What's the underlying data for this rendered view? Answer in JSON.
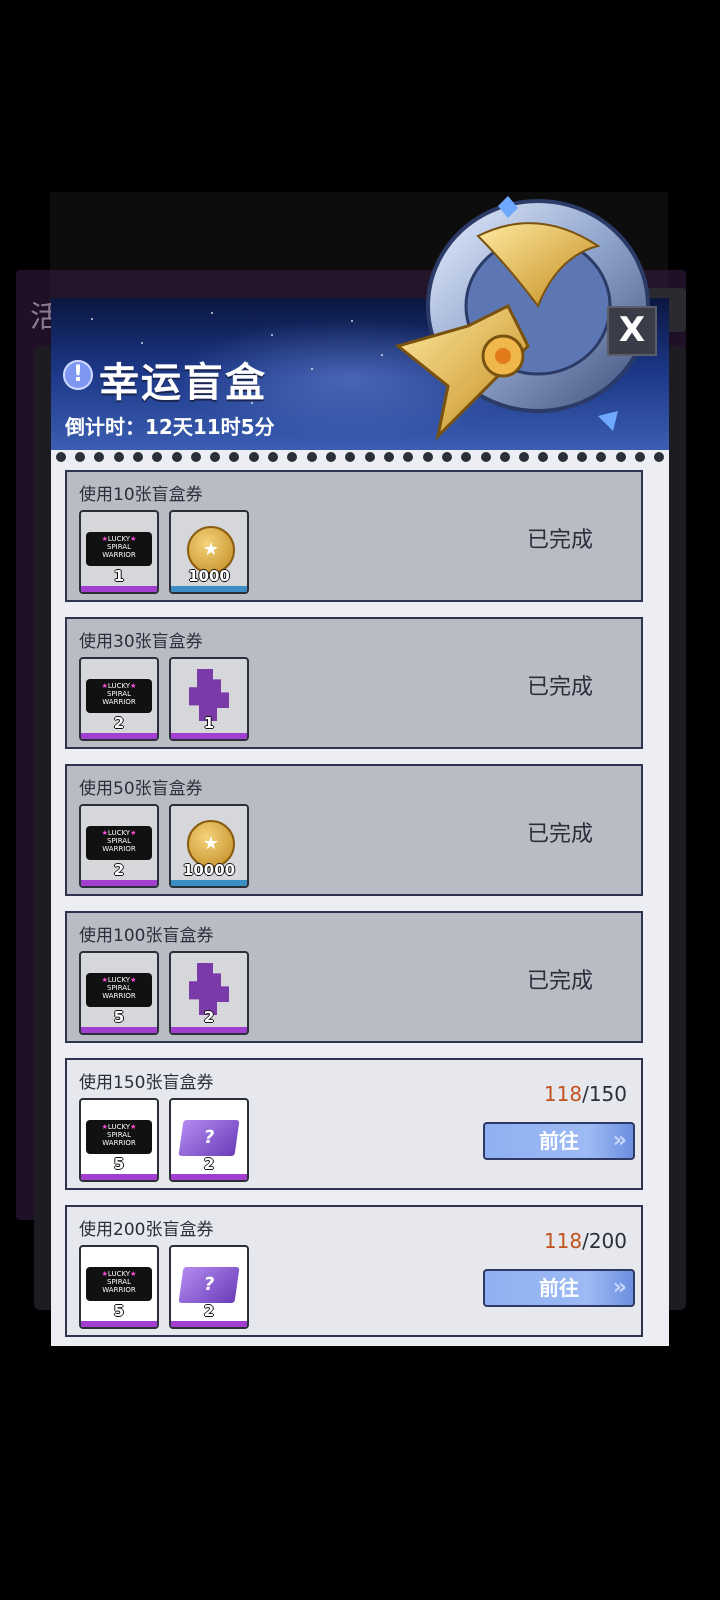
{
  "panel": {
    "title": "幸运盲盒",
    "countdown": "倒计时：12天11时5分",
    "close_label": "X"
  },
  "background": {
    "title_fragment": "活",
    "button_fragment": "X"
  },
  "tasks": [
    {
      "title": "使用10张盲盒券",
      "status": "已完成",
      "rewards": [
        {
          "icon": "lucky-ticket-icon",
          "qty": "1",
          "bar_color": "#a23fd0"
        },
        {
          "icon": "gold-coin-icon",
          "qty": "1000",
          "bar_color": "#3b8fc4"
        }
      ]
    },
    {
      "title": "使用30张盲盒券",
      "status": "已完成",
      "rewards": [
        {
          "icon": "lucky-ticket-icon",
          "qty": "2",
          "bar_color": "#a23fd0"
        },
        {
          "icon": "crystal-fragment-icon",
          "qty": "1",
          "bar_color": "#a23fd0"
        }
      ]
    },
    {
      "title": "使用50张盲盒券",
      "status": "已完成",
      "rewards": [
        {
          "icon": "lucky-ticket-icon",
          "qty": "2",
          "bar_color": "#a23fd0"
        },
        {
          "icon": "gold-coin-icon",
          "qty": "10000",
          "bar_color": "#3b8fc4"
        }
      ]
    },
    {
      "title": "使用100张盲盒券",
      "status": "已完成",
      "rewards": [
        {
          "icon": "lucky-ticket-icon",
          "qty": "5",
          "bar_color": "#a23fd0"
        },
        {
          "icon": "crystal-fragment-icon",
          "qty": "2",
          "bar_color": "#a23fd0"
        }
      ]
    },
    {
      "title": "使用150张盲盒券",
      "progress_current": "118",
      "progress_total": "/150",
      "button_label": "前往",
      "rewards": [
        {
          "icon": "lucky-ticket-icon",
          "qty": "5",
          "bar_color": "#a23fd0"
        },
        {
          "icon": "blind-box-ticket-icon",
          "qty": "2",
          "bar_color": "#a23fd0"
        }
      ]
    },
    {
      "title": "使用200张盲盒券",
      "progress_current": "118",
      "progress_total": "/200",
      "button_label": "前往",
      "rewards": [
        {
          "icon": "lucky-ticket-icon",
          "qty": "5",
          "bar_color": "#a23fd0"
        },
        {
          "icon": "blind-box-ticket-icon",
          "qty": "2",
          "bar_color": "#a23fd0"
        }
      ]
    }
  ],
  "ticket_text": [
    "LUCKY",
    "SPIRAL",
    "WARRIOR"
  ],
  "box_ticket_symbol": "?",
  "coin_symbol": "★"
}
